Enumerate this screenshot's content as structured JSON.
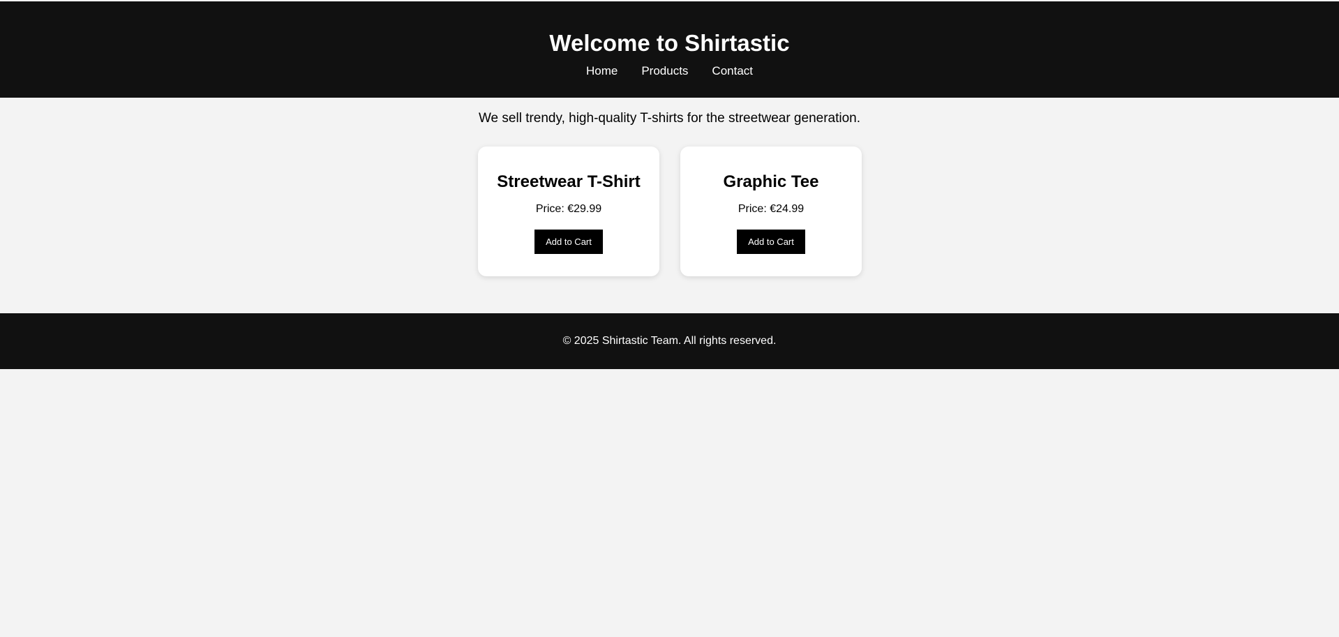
{
  "header": {
    "title": "Welcome to Shirtastic",
    "nav": [
      {
        "label": "Home"
      },
      {
        "label": "Products"
      },
      {
        "label": "Contact"
      }
    ]
  },
  "main": {
    "tagline": "We sell trendy, high-quality T-shirts for the streetwear generation.",
    "products": [
      {
        "name": "Streetwear T-Shirt",
        "price": "Price: €29.99",
        "button_label": "Add to Cart"
      },
      {
        "name": "Graphic Tee",
        "price": "Price: €24.99",
        "button_label": "Add to Cart"
      }
    ]
  },
  "footer": {
    "text": "© 2025 Shirtastic Team. All rights reserved."
  },
  "colors": {
    "header_bg": "#111111",
    "page_bg": "#f3f3f3",
    "button_bg": "#000000",
    "card_bg": "#ffffff"
  }
}
